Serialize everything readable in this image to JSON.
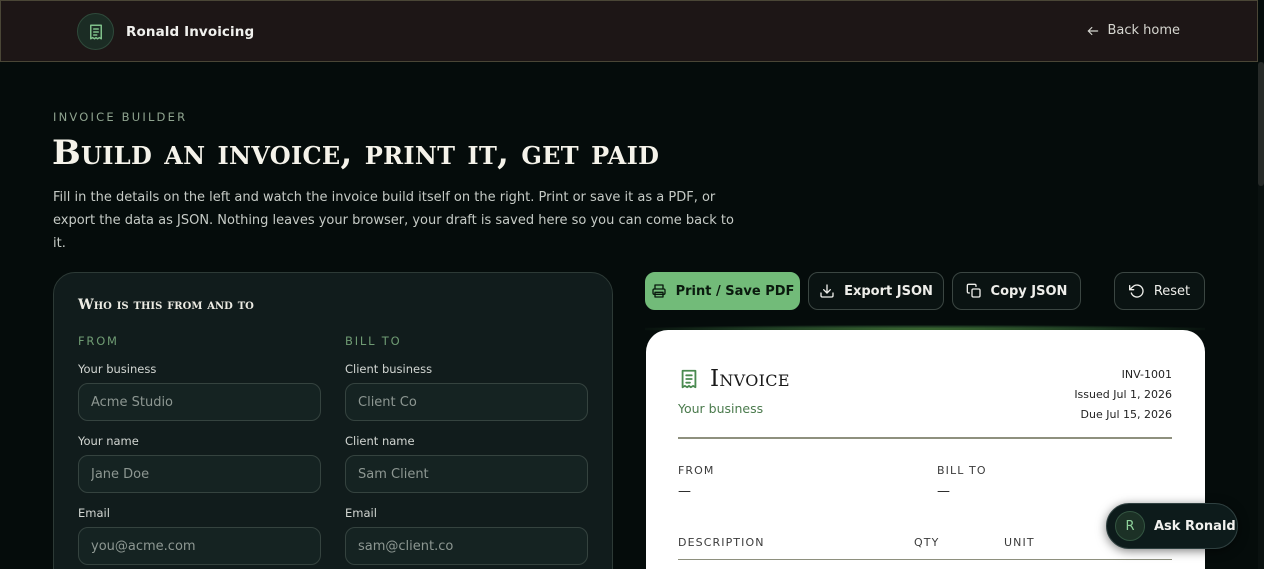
{
  "header": {
    "brand_name": "Ronald Invoicing",
    "back_home": "Back home"
  },
  "hero": {
    "eyebrow": "INVOICE BUILDER",
    "title": "Build an invoice, print it, get paid",
    "description": "Fill in the details on the left and watch the invoice build itself on the right. Print or save it as a PDF, or export the data as JSON. Nothing leaves your browser, your draft is saved here so you can come back to it."
  },
  "form": {
    "heading": "Who is this from and to",
    "from_label": "FROM",
    "bill_to_label": "BILL TO",
    "from": {
      "business_label": "Your business",
      "business_placeholder": "Acme Studio",
      "name_label": "Your name",
      "name_placeholder": "Jane Doe",
      "email_label": "Email",
      "email_placeholder": "you@acme.com"
    },
    "bill_to": {
      "business_label": "Client business",
      "business_placeholder": "Client Co",
      "name_label": "Client name",
      "name_placeholder": "Sam Client",
      "email_label": "Email",
      "email_placeholder": "sam@client.co"
    }
  },
  "actions": {
    "print": "Print / Save PDF",
    "export_json": "Export JSON",
    "copy_json": "Copy JSON",
    "reset": "Reset"
  },
  "invoice": {
    "title": "Invoice",
    "business": "Your business",
    "number": "INV-1001",
    "issued": "Issued Jul 1, 2026",
    "due": "Due Jul 15, 2026",
    "from_label": "FROM",
    "from_value": "—",
    "bill_to_label": "BILL TO",
    "bill_to_value": "—",
    "col_description": "DESCRIPTION",
    "col_qty": "QTY",
    "col_unit": "UNIT"
  },
  "assistant": {
    "avatar_letter": "R",
    "label": "Ask Ronald"
  },
  "colors": {
    "accent": "#72bb79",
    "background": "#050c0b",
    "card": "#111c1c"
  }
}
